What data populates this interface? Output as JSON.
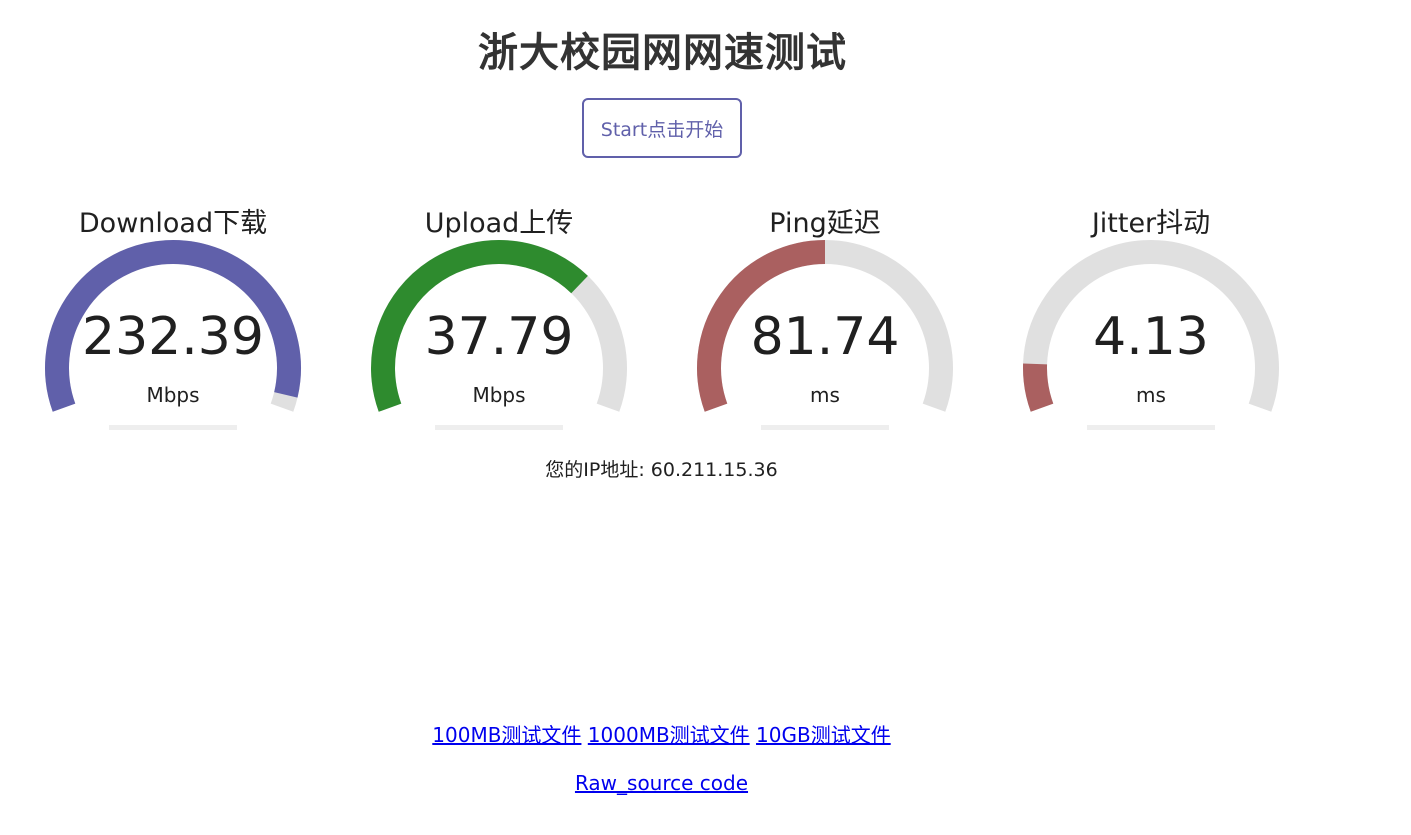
{
  "page": {
    "title": "浙大校园网网速测试",
    "start_button": "Start点击开始"
  },
  "gauges": [
    {
      "label": "Download下载",
      "value": "232.39",
      "unit": "Mbps",
      "fill": 0.97,
      "color": "#6060aa"
    },
    {
      "label": "Upload上传",
      "value": "37.79",
      "unit": "Mbps",
      "fill": 0.7,
      "color": "#2e8b2e"
    },
    {
      "label": "Ping延迟",
      "value": "81.74",
      "unit": "ms",
      "fill": 0.5,
      "color": "#aa6060"
    },
    {
      "label": "Jitter抖动",
      "value": "4.13",
      "unit": "ms",
      "fill": 0.1,
      "color": "#aa6060"
    }
  ],
  "track_color": "#e0e0e0",
  "ip_info": "您的IP地址: 60.211.15.36",
  "links": {
    "file_100mb": "100MB测试文件",
    "file_1000mb": "1000MB测试文件",
    "file_10gb": "10GB测试文件",
    "source_code": "Raw_source code"
  }
}
